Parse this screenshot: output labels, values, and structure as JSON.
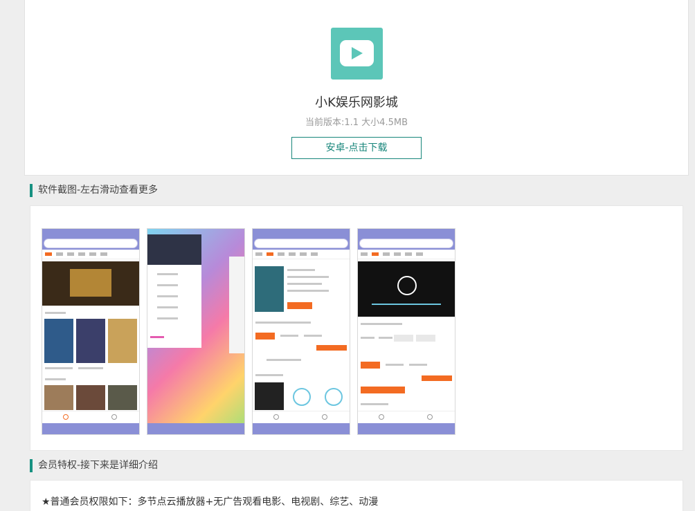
{
  "app": {
    "name": "小K娱乐网影城",
    "meta": "当前版本:1.1 大小4.5MB",
    "download_label": "安卓-点击下载",
    "icon": "play-icon",
    "accent_color": "#16857a",
    "icon_color": "#5cc6b8"
  },
  "screenshots_section": {
    "title": "软件截图-左右滑动查看更多"
  },
  "benefits_section": {
    "title": "会员特权-接下来是详细介绍",
    "line1": "★普通会员权限如下：多节点云播放器+无广告观看电影、电视剧、综艺、动漫"
  }
}
